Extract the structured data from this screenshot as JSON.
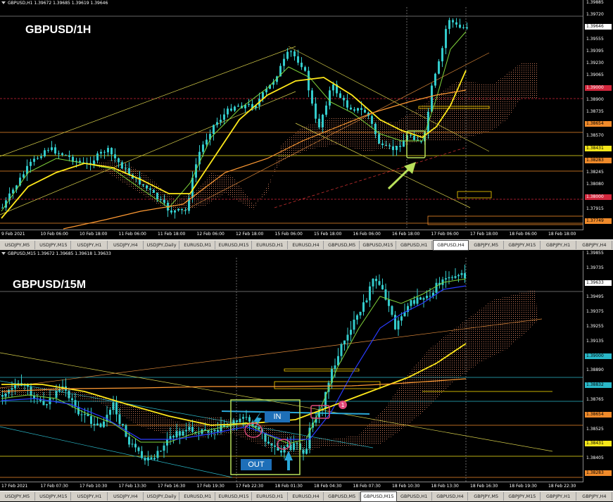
{
  "colors": {
    "background": "#000000",
    "candle": "#33cccc",
    "ma_fast": "#7fd33a",
    "ma_mid": "#ffe81a",
    "ma_slow": "#ff9a33",
    "ma_blue": "#2a3cff",
    "cloud": "#c8785a",
    "annotation": "#b8e05a",
    "tag_blue": "#1e6fb8",
    "marker_pink": "#e04a7a"
  },
  "chart1": {
    "header": "GBPUSD,H1  1.39672 1.39685 1.39619 1.39646",
    "title": "GBPUSD/1H",
    "price_labels": [
      {
        "text": "1.39885",
        "style": "plain"
      },
      {
        "text": "1.39720",
        "style": "plain"
      },
      {
        "text": "1.39646",
        "style": "current"
      },
      {
        "text": "1.39555",
        "style": "plain"
      },
      {
        "text": "1.39395",
        "style": "plain"
      },
      {
        "text": "1.39230",
        "style": "plain"
      },
      {
        "text": "1.39065",
        "style": "plain"
      },
      {
        "text": "1.39000",
        "style": "red"
      },
      {
        "text": "1.38900",
        "style": "plain"
      },
      {
        "text": "1.38735",
        "style": "plain"
      },
      {
        "text": "1.38654",
        "style": "orange"
      },
      {
        "text": "1.38570",
        "style": "plain"
      },
      {
        "text": "1.38431",
        "style": "yellow"
      },
      {
        "text": "1.38283",
        "style": "orange"
      },
      {
        "text": "1.38245",
        "style": "plain"
      },
      {
        "text": "1.38080",
        "style": "plain"
      },
      {
        "text": "1.38000",
        "style": "red"
      },
      {
        "text": "1.37915",
        "style": "plain"
      },
      {
        "text": "1.37749",
        "style": "orange"
      }
    ],
    "time_labels": [
      "9 Feb 2021",
      "10 Feb 06:00",
      "10 Feb 18:00",
      "11 Feb 06:00",
      "11 Feb 18:00",
      "12 Feb 06:00",
      "12 Feb 18:00",
      "15 Feb 06:00",
      "15 Feb 18:00",
      "16 Feb 06:00",
      "16 Feb 18:00",
      "17 Feb 06:00",
      "17 Feb 18:00",
      "18 Feb 06:00",
      "18 Feb 18:00"
    ]
  },
  "chart2": {
    "header": "GBPUSD,M15  1.39672 1.39685 1.39618 1.39633",
    "title": "GBPUSD/15M",
    "in_label": "IN",
    "out_label": "OUT",
    "marker_label": "1",
    "price_labels": [
      {
        "text": "1.39855",
        "style": "plain"
      },
      {
        "text": "1.39735",
        "style": "plain"
      },
      {
        "text": "1.39633",
        "style": "current"
      },
      {
        "text": "1.39495",
        "style": "plain"
      },
      {
        "text": "1.39375",
        "style": "plain"
      },
      {
        "text": "1.39255",
        "style": "plain"
      },
      {
        "text": "1.39135",
        "style": "plain"
      },
      {
        "text": "1.39000",
        "style": "cyan"
      },
      {
        "text": "1.38890",
        "style": "plain"
      },
      {
        "text": "1.38832",
        "style": "cyan"
      },
      {
        "text": "1.38765",
        "style": "plain"
      },
      {
        "text": "1.38654",
        "style": "orange"
      },
      {
        "text": "1.38525",
        "style": "plain"
      },
      {
        "text": "1.38431",
        "style": "yellow"
      },
      {
        "text": "1.38405",
        "style": "plain"
      },
      {
        "text": "1.38283",
        "style": "orange"
      }
    ],
    "time_labels": [
      "17 Feb 2021",
      "17 Feb 07:30",
      "17 Feb 10:30",
      "17 Feb 13:30",
      "17 Feb 16:30",
      "17 Feb 19:30",
      "17 Feb 22:30",
      "18 Feb 01:30",
      "18 Feb 04:30",
      "18 Feb 07:30",
      "18 Feb 10:30",
      "18 Feb 13:30",
      "18 Feb 16:30",
      "18 Feb 19:30",
      "18 Feb 22:30"
    ]
  },
  "tabs1": {
    "active": 12,
    "items": [
      "USDJPY,M5",
      "USDJPY,M15",
      "USDJPY,H1",
      "USDJPY,H4",
      "USDJPY,Daily",
      "EURUSD,M1",
      "EURUSD,M15",
      "EURUSD,H1",
      "EURUSD,H4",
      "GBPUSD,M5",
      "GBPUSD,M15",
      "GBPUSD,H1",
      "GBPUSD,H4",
      "GBPJPY,M5",
      "GBPJPY,M15",
      "GBPJPY,H1",
      "GBPJPY,H4"
    ]
  },
  "tabs2": {
    "active": 10,
    "items": [
      "USDJPY,M5",
      "USDJPY,M15",
      "USDJPY,H1",
      "USDJPY,H4",
      "USDJPY,Daily",
      "EURUSD,M1",
      "EURUSD,M15",
      "EURUSD,H1",
      "EURUSD,H4",
      "GBPUSD,M5",
      "GBPUSD,M15",
      "GBPUSD,H1",
      "GBPUSD,H4",
      "GBPJPY,M5",
      "GBPJPY,M15",
      "GBPJPY,H1",
      "GBPJPY,H4"
    ]
  }
}
